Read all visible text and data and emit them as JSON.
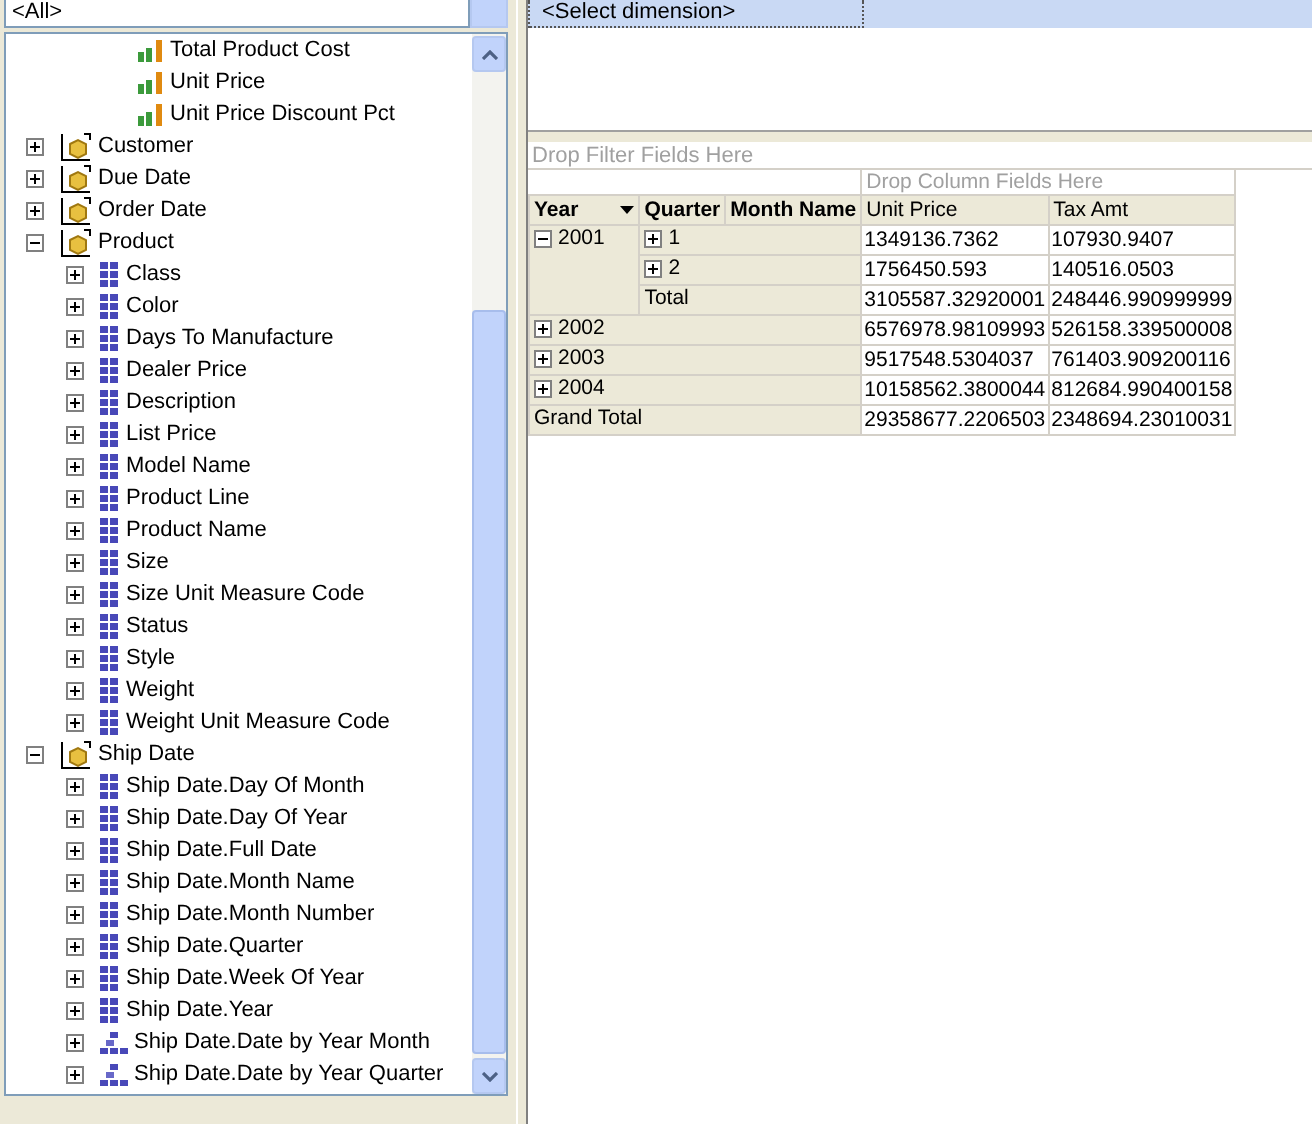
{
  "filter_dropdown": {
    "value": "<All>"
  },
  "tree": [
    {
      "kind": "measure",
      "label": "Total Product Cost"
    },
    {
      "kind": "measure",
      "label": "Unit Price"
    },
    {
      "kind": "measure",
      "label": "Unit Price Discount Pct"
    },
    {
      "kind": "dimension",
      "label": "Customer",
      "expanded": false
    },
    {
      "kind": "dimension",
      "label": "Due Date",
      "expanded": false
    },
    {
      "kind": "dimension",
      "label": "Order Date",
      "expanded": false
    },
    {
      "kind": "dimension",
      "label": "Product",
      "expanded": true,
      "children": [
        {
          "kind": "attribute",
          "label": "Class",
          "expanded": false
        },
        {
          "kind": "attribute",
          "label": "Color",
          "expanded": false
        },
        {
          "kind": "attribute",
          "label": "Days To Manufacture",
          "expanded": false
        },
        {
          "kind": "attribute",
          "label": "Dealer Price",
          "expanded": false
        },
        {
          "kind": "attribute",
          "label": "Description",
          "expanded": false
        },
        {
          "kind": "attribute",
          "label": "List Price",
          "expanded": false
        },
        {
          "kind": "attribute",
          "label": "Model Name",
          "expanded": false
        },
        {
          "kind": "attribute",
          "label": "Product Line",
          "expanded": false
        },
        {
          "kind": "attribute",
          "label": "Product Name",
          "expanded": false
        },
        {
          "kind": "attribute",
          "label": "Size",
          "expanded": false
        },
        {
          "kind": "attribute",
          "label": "Size Unit Measure Code",
          "expanded": false
        },
        {
          "kind": "attribute",
          "label": "Status",
          "expanded": false
        },
        {
          "kind": "attribute",
          "label": "Style",
          "expanded": false
        },
        {
          "kind": "attribute",
          "label": "Weight",
          "expanded": false
        },
        {
          "kind": "attribute",
          "label": "Weight Unit Measure Code",
          "expanded": false
        }
      ]
    },
    {
      "kind": "dimension",
      "label": "Ship Date",
      "expanded": true,
      "children": [
        {
          "kind": "attribute",
          "label": "Ship Date.Day Of Month",
          "expanded": false
        },
        {
          "kind": "attribute",
          "label": "Ship Date.Day Of Year",
          "expanded": false
        },
        {
          "kind": "attribute",
          "label": "Ship Date.Full Date",
          "expanded": false
        },
        {
          "kind": "attribute",
          "label": "Ship Date.Month Name",
          "expanded": false
        },
        {
          "kind": "attribute",
          "label": "Ship Date.Month Number",
          "expanded": false
        },
        {
          "kind": "attribute",
          "label": "Ship Date.Quarter",
          "expanded": false
        },
        {
          "kind": "attribute",
          "label": "Ship Date.Week Of Year",
          "expanded": false
        },
        {
          "kind": "attribute",
          "label": "Ship Date.Year",
          "expanded": false
        },
        {
          "kind": "hierarchy",
          "label": "Ship Date.Date by Year Month",
          "expanded": false
        },
        {
          "kind": "hierarchy",
          "label": "Ship Date.Date by Year Quarter",
          "expanded": false
        }
      ]
    }
  ],
  "dimension_selector": {
    "value": "<Select dimension>"
  },
  "pivot": {
    "filter_drop_zone": "Drop Filter Fields Here",
    "column_drop_zone": "Drop Column Fields Here",
    "row_fields": [
      "Year",
      "Quarter",
      "Month Name"
    ],
    "measures": [
      "Unit Price",
      "Tax Amt"
    ],
    "years": [
      {
        "label": "2001",
        "expanded": true,
        "quarters": [
          {
            "label": "1",
            "expanded": false,
            "values": [
              "1349136.7362",
              "107930.9407"
            ]
          },
          {
            "label": "2",
            "expanded": false,
            "values": [
              "1756450.593",
              "140516.0503"
            ]
          }
        ],
        "total": {
          "label": "Total",
          "values": [
            "3105587.32920001",
            "248446.990999999"
          ]
        }
      },
      {
        "label": "2002",
        "expanded": false,
        "values": [
          "6576978.98109993",
          "526158.339500008"
        ]
      },
      {
        "label": "2003",
        "expanded": false,
        "values": [
          "9517548.5304037",
          "761403.909200116"
        ]
      },
      {
        "label": "2004",
        "expanded": false,
        "values": [
          "10158562.3800044",
          "812684.990400158"
        ]
      }
    ],
    "grand_total": {
      "label": "Grand Total",
      "values": [
        "29358677.2206503",
        "2348694.23010031"
      ]
    }
  }
}
